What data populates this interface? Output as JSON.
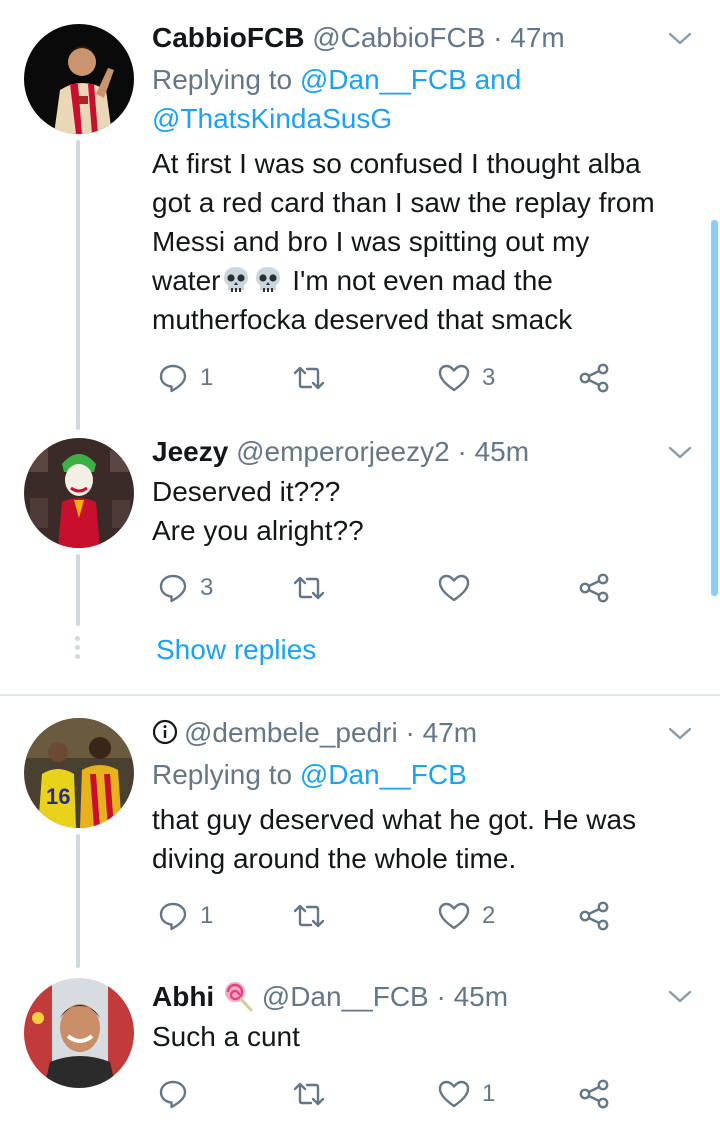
{
  "tweets": [
    {
      "display_name": "CabbioFCB",
      "handle": "@CabbioFCB",
      "time": "47m",
      "replying_label": "Replying to",
      "replying_mentions_1": "@Dan__FCB",
      "replying_and": "and",
      "replying_mentions_2": "@ThatsKindaSusG",
      "text_lines": [
        "At first I was so confused I thought alba",
        "got a red card than I saw the replay from",
        "Messi and bro I was spitting out my",
        "water",
        " I'm not even mad the",
        "mutherfocka deserved that smack"
      ],
      "replies": "1",
      "retweets": "",
      "likes": "3"
    },
    {
      "display_name": "Jeezy",
      "handle": "@emperorjeezy2",
      "time": "45m",
      "text_lines": [
        "Deserved it???",
        "Are you alright??"
      ],
      "replies": "3",
      "retweets": "",
      "likes": ""
    },
    {
      "display_name": "",
      "handle": "@dembele_pedri",
      "time": "47m",
      "replying_label": "Replying to",
      "replying_mentions_1": "@Dan__FCB",
      "text_lines": [
        "that guy deserved what he got. He was",
        "diving around the whole time."
      ],
      "replies": "1",
      "retweets": "",
      "likes": "2"
    },
    {
      "display_name": "Abhi",
      "handle": "@Dan__FCB",
      "time": "45m",
      "text_lines": [
        "Such a cunt"
      ],
      "replies": "",
      "retweets": "",
      "likes": "1"
    }
  ],
  "separator": "·",
  "show_replies_label": "Show replies",
  "colors": {
    "link": "#1da1f2",
    "secondary_text": "#657786",
    "thread_line": "#cfd9de",
    "scrollbar": "#8ecdf5"
  },
  "icons": {
    "reply": "reply-icon",
    "retweet": "retweet-icon",
    "like": "heart-icon",
    "share": "share-icon",
    "caret": "chevron-down-icon",
    "info": "info-icon",
    "emoji_skull": "skull-emoji",
    "emoji_lollipop": "lollipop-emoji"
  }
}
